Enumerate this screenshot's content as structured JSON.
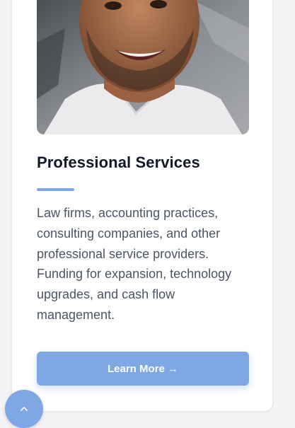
{
  "colors": {
    "accent": "#7fa7e4",
    "title": "#111827",
    "text": "#4b5563",
    "card_bg": "#ffffff",
    "page_bg": "#f3f4f6"
  },
  "card": {
    "image_alt": "Portrait of a smiling man",
    "title": "Professional Services",
    "description": "Law firms, accounting practices, consulting companies, and other professional service providers. Funding for expansion, technology upgrades, and cash flow management.",
    "button_label": "Learn More →"
  },
  "scroll_top": {
    "icon": "chevron-up-icon"
  }
}
